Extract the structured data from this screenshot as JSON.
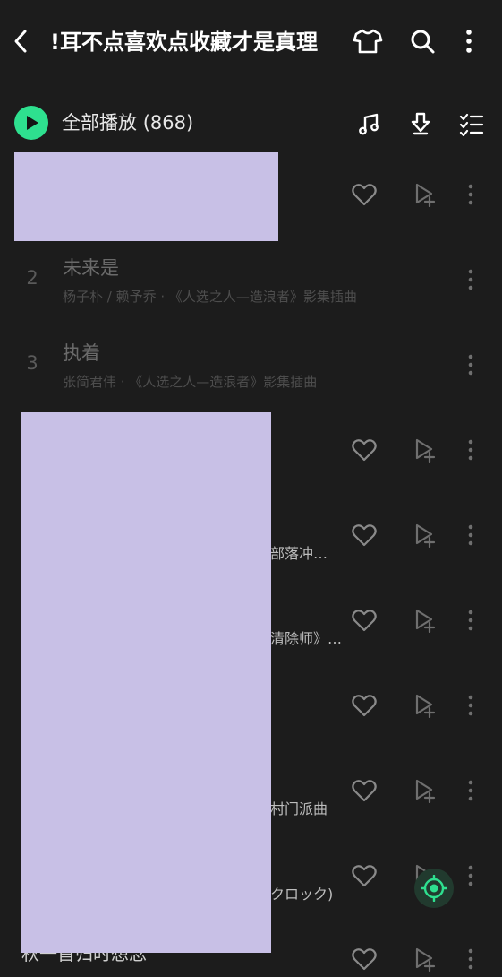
{
  "header": {
    "title": "!耳不点喜欢点收藏才是真理",
    "icons": [
      "back-arrow-icon",
      "tshirt-icon",
      "search-icon",
      "more-vertical-icon"
    ]
  },
  "playall": {
    "label": "全部播放",
    "count": "(868)",
    "icons": [
      "music-note-icon",
      "download-icon",
      "multi-select-icon"
    ]
  },
  "songs": [
    {
      "index": "2",
      "title": "未来是",
      "subtitle": "杨子朴 / 赖予乔 · 《人选之人—造浪者》影集插曲"
    },
    {
      "index": "3",
      "title": "执着",
      "subtitle": "张简君伟 · 《人选之人—造浪者》影集插曲"
    }
  ],
  "visible_tails": [
    "部落冲…",
    "清除师》…",
    "村门派曲",
    "クロック)"
  ],
  "bottom_partial_text": "秋一首归时想念"
}
